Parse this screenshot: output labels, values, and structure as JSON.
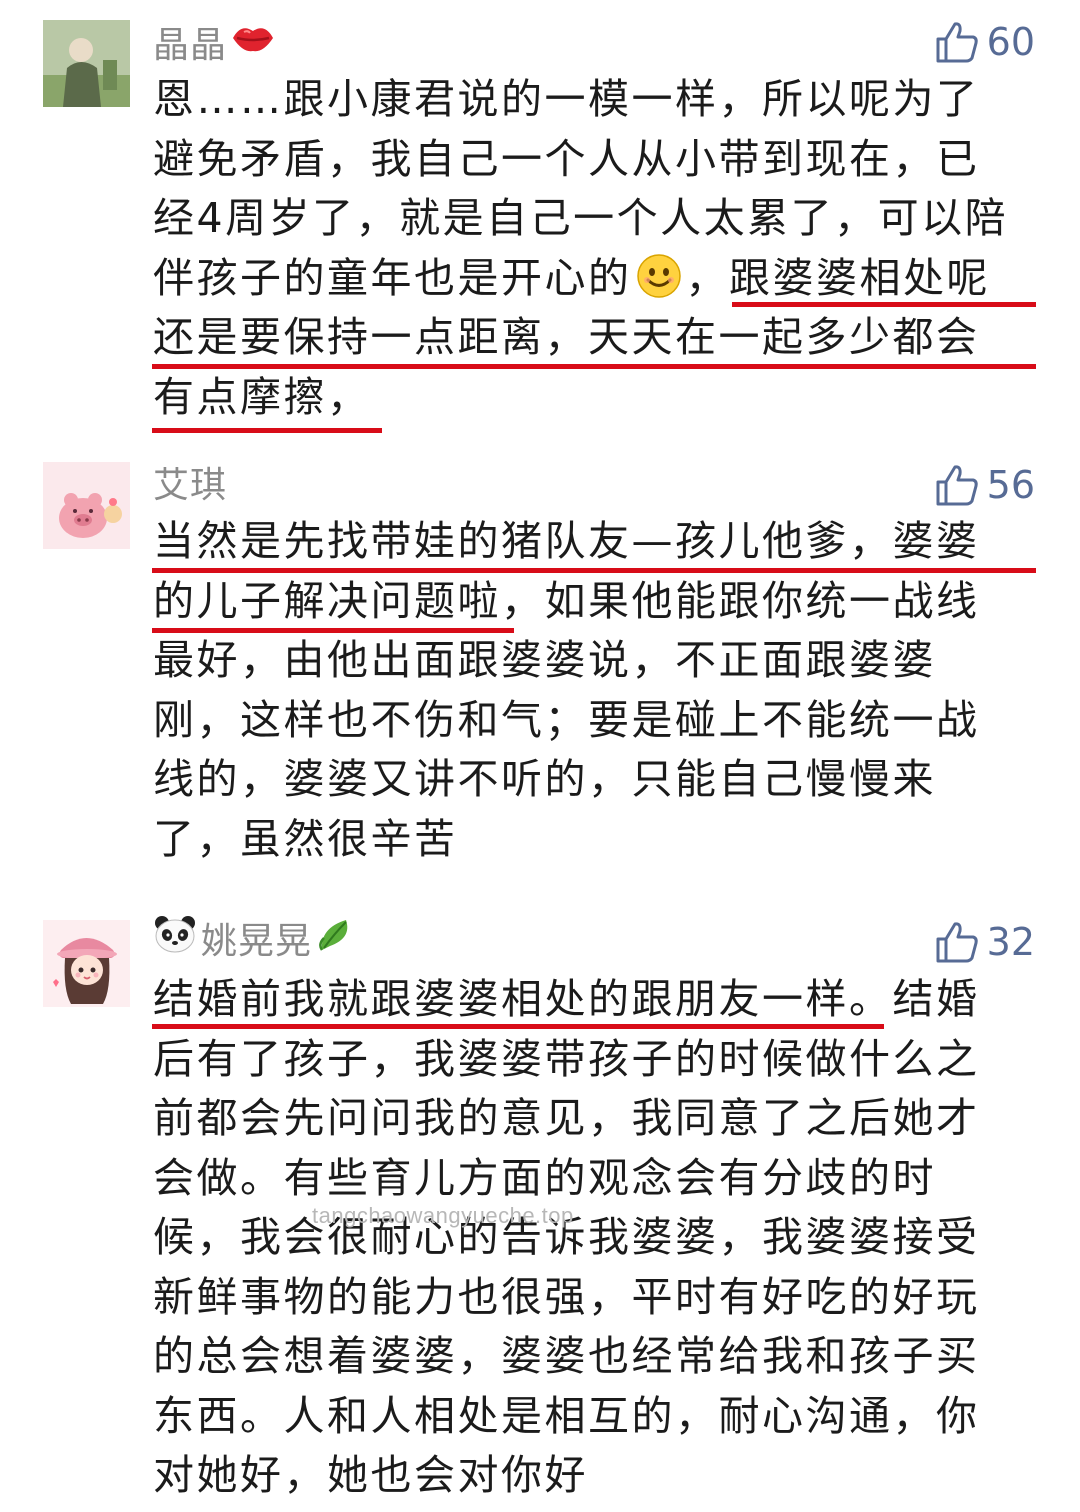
{
  "comments": [
    {
      "name": "晶晶",
      "likes": "60",
      "lines": [
        "恩……跟小康君说的一模一样，所以呢为了",
        "避免矛盾，我自己一个人从小带到现在，已",
        "经4周岁了，就是自己一个人太累了，可以陪",
        "伴孩子的童年也是开心的",
        "，跟婆婆相处呢",
        "还是要保持一点距离，天天在一起多少都会",
        "有点摩擦，"
      ]
    },
    {
      "name": "艾琪",
      "likes": "56",
      "lines": [
        "当然是先找带娃的猪队友—孩儿他爹，婆婆",
        "的儿子解决问题啦，如果他能跟你统一战线",
        "最好，由他出面跟婆婆说，不正面跟婆婆",
        "刚，这样也不伤和气；要是碰上不能统一战",
        "线的，婆婆又讲不听的，只能自己慢慢来",
        "了，虽然很辛苦"
      ]
    },
    {
      "name": "姚晃晃",
      "likes": "32",
      "lines": [
        "结婚前我就跟婆婆相处的跟朋友一样。结婚",
        "后有了孩子，我婆婆带孩子的时候做什么之",
        "前都会先问问我的意见，我同意了之后她才",
        "会做。有些育儿方面的观念会有分歧的时",
        "候，我会很耐心的告诉我婆婆，我婆婆接受",
        "新鲜事物的能力也很强，平时有好吃的好玩",
        "的总会想着婆婆，婆婆也经常给我和孩子买",
        "东西。人和人相处是相互的，耐心沟通，你",
        "对她好，她也会对你好"
      ]
    }
  ],
  "watermark": "tangchaowangyueche.top",
  "colors": {
    "like": "#576b95",
    "name": "#8a8a8a",
    "underline": "#d80c18",
    "text": "#1b1b1b"
  },
  "icons": [
    "lips-icon",
    "thumbs-up-icon",
    "panda-icon",
    "leaf-icon",
    "smile-emoji-icon"
  ]
}
